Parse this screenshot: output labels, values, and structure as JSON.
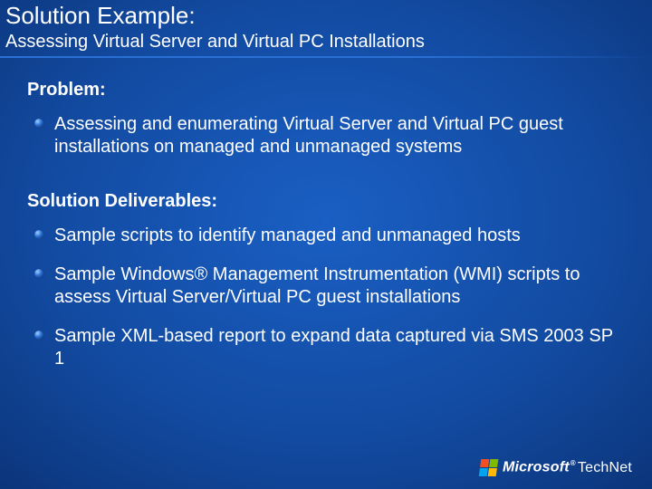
{
  "title": "Solution Example:",
  "subtitle": "Assessing Virtual Server and Virtual PC Installations",
  "sections": [
    {
      "heading": "Problem:",
      "items": [
        "Assessing and enumerating Virtual Server and Virtual PC guest installations on managed and unmanaged systems"
      ]
    },
    {
      "heading": "Solution Deliverables:",
      "items": [
        "Sample scripts to identify managed and unmanaged hosts",
        "Sample Windows® Management Instrumentation (WMI) scripts to assess Virtual Server/Virtual PC  guest installations",
        "Sample XML-based report to expand data captured via SMS 2003 SP 1"
      ]
    }
  ],
  "footer": {
    "brand": "Microsoft",
    "sub": "TechNet"
  }
}
